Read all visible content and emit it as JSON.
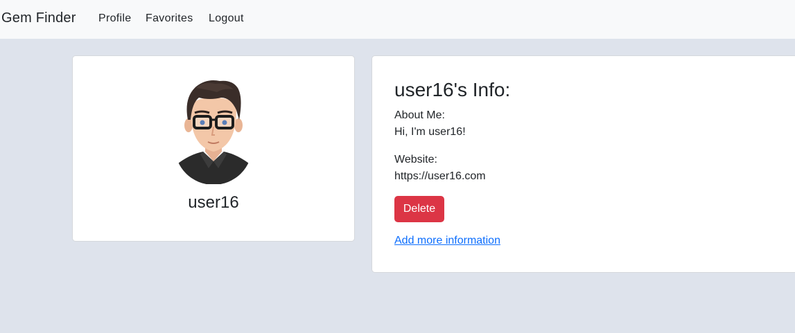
{
  "navbar": {
    "brand": "Gem Finder",
    "links": [
      "Profile",
      "Favorites",
      "Logout"
    ]
  },
  "profile_card": {
    "avatar_icon": "user-avatar-icon",
    "username": "user16"
  },
  "info_card": {
    "title": "user16's Info:",
    "about_label": "About Me:",
    "about_value": "Hi, I'm user16!",
    "website_label": "Website:",
    "website_value": "https://user16.com",
    "delete_label": "Delete",
    "add_more_label": "Add more information"
  },
  "colors": {
    "page_bg": "#dee3ec",
    "navbar_bg": "#f8f9fa",
    "danger": "#dc3545",
    "link": "#0d6efd"
  }
}
